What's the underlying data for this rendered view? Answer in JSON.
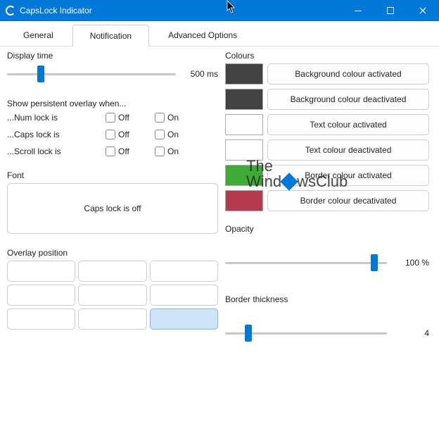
{
  "window": {
    "title": "CapsLock Indicator"
  },
  "tabs": {
    "general": "General",
    "notification": "Notification",
    "advanced": "Advanced Options"
  },
  "display_time": {
    "title": "Display time",
    "value": "500 ms",
    "thumb_pct": 18
  },
  "persistent": {
    "title": "Show persistent overlay when...",
    "num": "...Num lock is",
    "caps": "...Caps lock is",
    "scroll": "...Scroll lock is",
    "off": "Off",
    "on": "On"
  },
  "font": {
    "title": "Font",
    "sample": "Caps lock is off"
  },
  "position": {
    "title": "Overlay position"
  },
  "colours": {
    "title": "Colours",
    "bg_act": {
      "label": "Background colour activated",
      "hex": "#424242"
    },
    "bg_deact": {
      "label": "Background colour deactivated",
      "hex": "#424242"
    },
    "text_act": {
      "label": "Text colour activated",
      "hex": "#ffffff"
    },
    "text_deact": {
      "label": "Text colour deactivated",
      "hex": "#ffffff"
    },
    "border_act": {
      "label": "Border colour activated",
      "hex": "#3faa36"
    },
    "border_deact": {
      "label": "Border colour decativated",
      "hex": "#b43a4c"
    }
  },
  "opacity": {
    "title": "Opacity",
    "value": "100 %",
    "thumb_pct": 90
  },
  "border": {
    "title": "Border thickness",
    "value": "4",
    "thumb_pct": 12
  },
  "watermark": {
    "line1": "The",
    "line2a": "Wind",
    "line2b": "wsClub"
  }
}
